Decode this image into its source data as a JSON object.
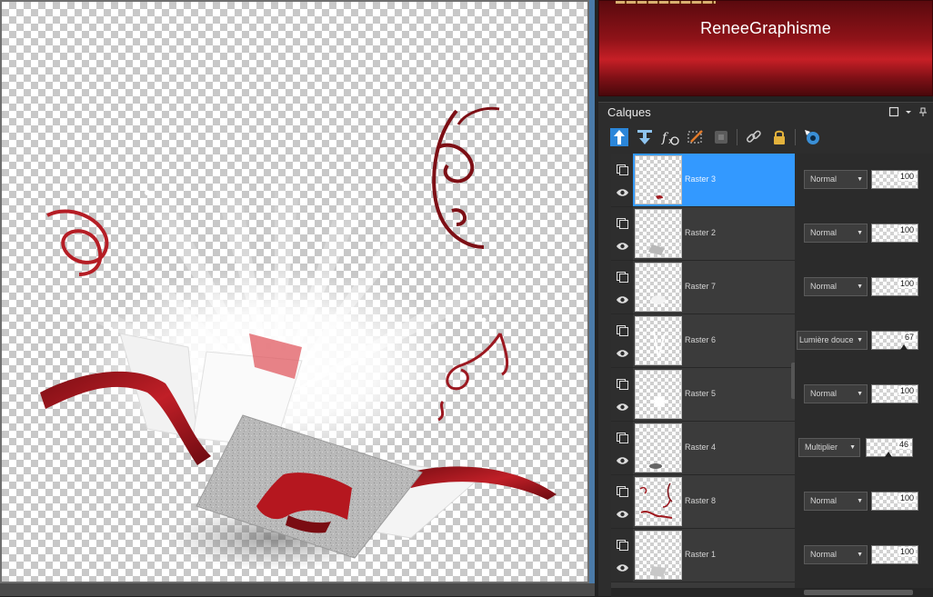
{
  "banner": {
    "title": "ReneeGraphisme",
    "accent_color": "#c61f26"
  },
  "layers_panel": {
    "title": "Calques",
    "toolbar": [
      "new-raster-layer-icon",
      "merge-down-icon",
      "fx-effects-icon",
      "mask-icon",
      "layer-properties-icon",
      "link-icon",
      "lock-icon",
      "visibility-toggle-icon"
    ],
    "layers": [
      {
        "name": "Raster 3",
        "blend_mode": "Normal",
        "opacity": "100",
        "selected": true
      },
      {
        "name": "Raster 2",
        "blend_mode": "Normal",
        "opacity": "100",
        "selected": false
      },
      {
        "name": "Raster 7",
        "blend_mode": "Normal",
        "opacity": "100",
        "selected": false
      },
      {
        "name": "Raster 6",
        "blend_mode": "Lumière douce",
        "opacity": "67",
        "selected": false
      },
      {
        "name": "Raster 5",
        "blend_mode": "Normal",
        "opacity": "100",
        "selected": false
      },
      {
        "name": "Raster 4",
        "blend_mode": "Multiplier",
        "opacity": "46",
        "selected": false
      },
      {
        "name": "Raster 8",
        "blend_mode": "Normal",
        "opacity": "100",
        "selected": false
      },
      {
        "name": "Raster 1",
        "blend_mode": "Normal",
        "opacity": "100",
        "selected": false
      }
    ],
    "selected_color": "#3399ff"
  }
}
